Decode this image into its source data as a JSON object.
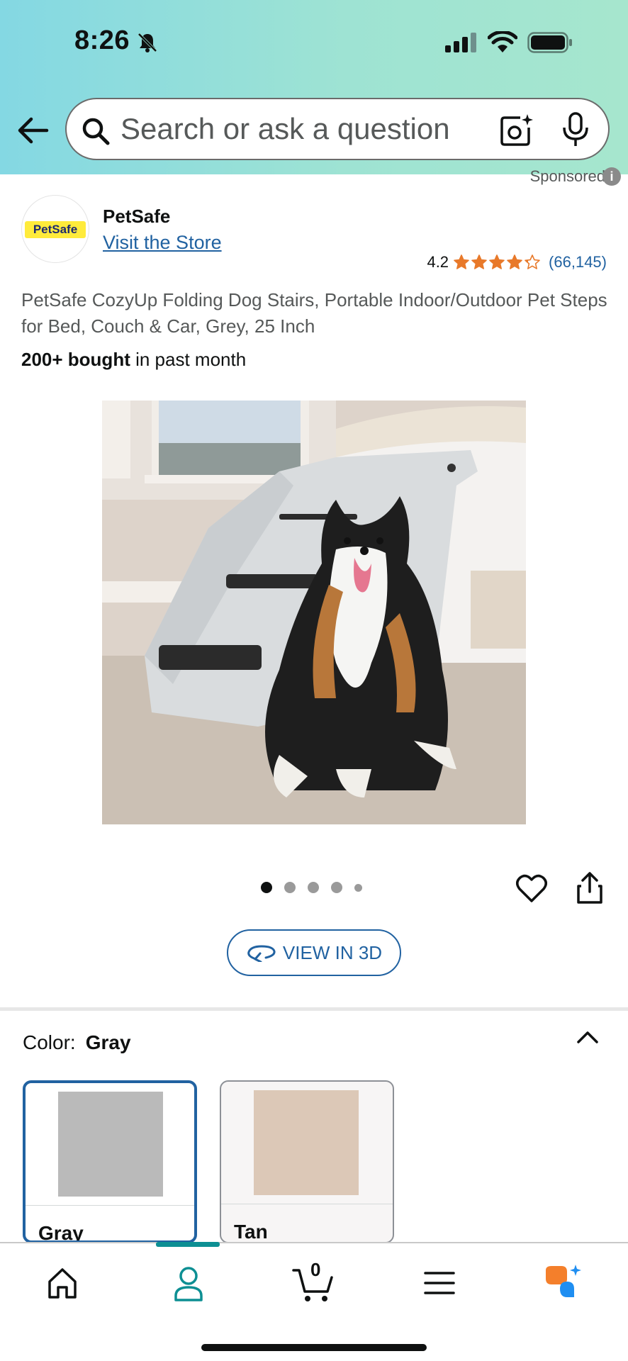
{
  "status_bar": {
    "time": "8:26"
  },
  "search": {
    "placeholder": "Search or ask a question"
  },
  "ad": {
    "label": "Sponsored",
    "info_glyph": "i"
  },
  "brand": {
    "logo_text": "PetSafe",
    "name": "PetSafe",
    "store_link": "Visit the Store",
    "rating": "4.2",
    "rating_stars": 4.2,
    "review_count": "(66,145)"
  },
  "product": {
    "title": "PetSafe CozyUp Folding Dog Stairs, Portable Indoor/Outdoor Pet Steps for Bed, Couch & Car, Grey, 25 Inch",
    "bought_bold": "200+ bought",
    "bought_rest": " in past month",
    "image_count": 5,
    "active_image": 0
  },
  "view3d": {
    "label": "VIEW IN 3D"
  },
  "color_selector": {
    "label": "Color:",
    "selected": "Gray",
    "options": [
      {
        "label": "Gray",
        "color": "#bababa"
      },
      {
        "label": "Tan",
        "color": "#dcc8b7"
      }
    ]
  },
  "bottom_nav": {
    "cart_count": "0",
    "active": "profile"
  },
  "colors": {
    "accent_link": "#2162a1",
    "star": "#e8792a",
    "nav_active": "#0d8f93",
    "ai_orange": "#f47f2b",
    "ai_blue": "#1f8ef1"
  }
}
